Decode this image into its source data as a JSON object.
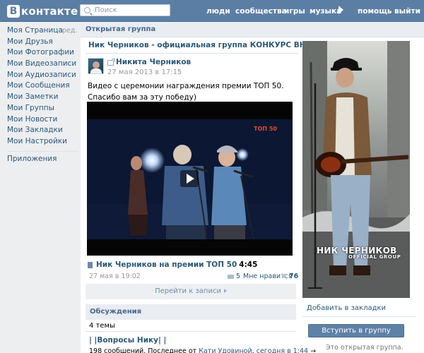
{
  "header": {
    "logo_letter": "В",
    "logo_text": "контакте",
    "search_placeholder": "Поиск",
    "nav": [
      "люди",
      "сообщества",
      "игры",
      "музыка",
      "помощь",
      "выйти"
    ]
  },
  "sidebar": {
    "edit_label": "ред.",
    "items": [
      "Моя Страница",
      "Мои Друзья",
      "Мои Фотографии",
      "Мои Видеозаписи",
      "Мои Аудиозаписи",
      "Мои Сообщения",
      "Мои Заметки",
      "Мои Группы",
      "Мои Новости",
      "Мои Закладки",
      "Мои Настройки"
    ],
    "apps": "Приложения"
  },
  "main": {
    "breadcrumb": "Открытая группа",
    "group_title": "Ник Черников - официальная группа КОНКУРС ВНУТРИ",
    "post": {
      "author": "Никита Черников",
      "date": "27 мая 2013 в 17:15",
      "text": "Видео с церемонии награждения премии ТОП 50. Спасибо вам за эту победу)",
      "video_watermark": "ТОП 50",
      "video_title": "Ник Черников на премии ТОП 50",
      "video_duration": "4:45",
      "meta_date": "27 мая в 19:02",
      "comments": "5",
      "likes_label": "Мне нравится",
      "likes": "76",
      "goto": "Перейти к записи"
    },
    "discussions": {
      "header": "Обсуждения",
      "count": "4 темы",
      "topic": "| |Вопросы Нику| |",
      "last_prefix": "198 сообщений. Последнее от",
      "last_author": "Кати Удовиной",
      "last_time": "сегодня в 1:44",
      "arrow": "→"
    }
  },
  "right": {
    "cover_name": "НИК ЧЕРНИКОВ",
    "cover_sub": "OFFICIAL GROUP",
    "bookmark": "Добавить в закладки",
    "join": "Вступить в группу",
    "note": "Это открытая группа."
  },
  "colors": {
    "header": "#5b7ea5",
    "link": "#2b587a",
    "join_button": "#5e81a8"
  }
}
